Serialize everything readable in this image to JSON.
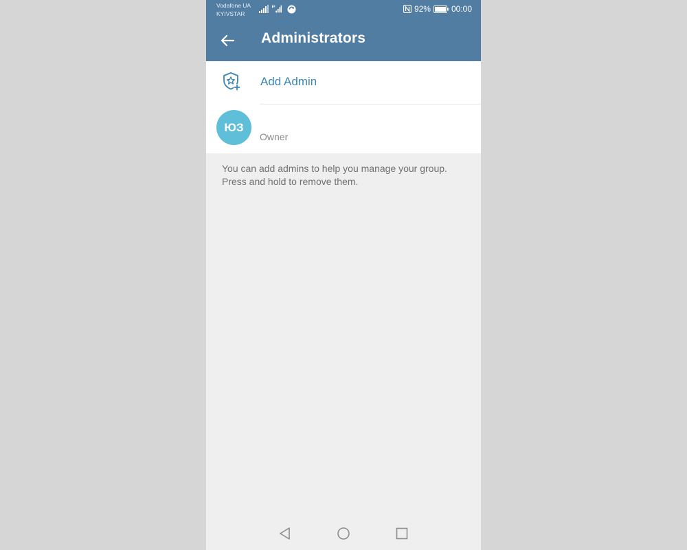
{
  "status_bar": {
    "carrier_1": "Vodafone UA",
    "carrier_2": "KYIVSTAR",
    "battery_percent": "92%",
    "time": "00:00",
    "icons": [
      "signal-icon",
      "signal-icon",
      "sync-icon",
      "nfc-icon",
      "battery-icon"
    ]
  },
  "app_bar": {
    "title": "Administrators",
    "back_icon": "back-arrow-icon"
  },
  "list": {
    "add_admin": {
      "label": "Add Admin",
      "icon": "shield-star-add-icon"
    },
    "owner": {
      "avatar_initials": "ЮЗ",
      "name": "",
      "role": "Owner"
    }
  },
  "hint": "You can add admins to help you manage your group. Press and hold to remove them.",
  "nav_bar": {
    "icons": [
      "nav-back-icon",
      "nav-home-icon",
      "nav-recents-icon"
    ]
  },
  "colors": {
    "header": "#517da2",
    "accent": "#3a86b8",
    "avatar": "#5fbed8",
    "background": "#efefef"
  }
}
